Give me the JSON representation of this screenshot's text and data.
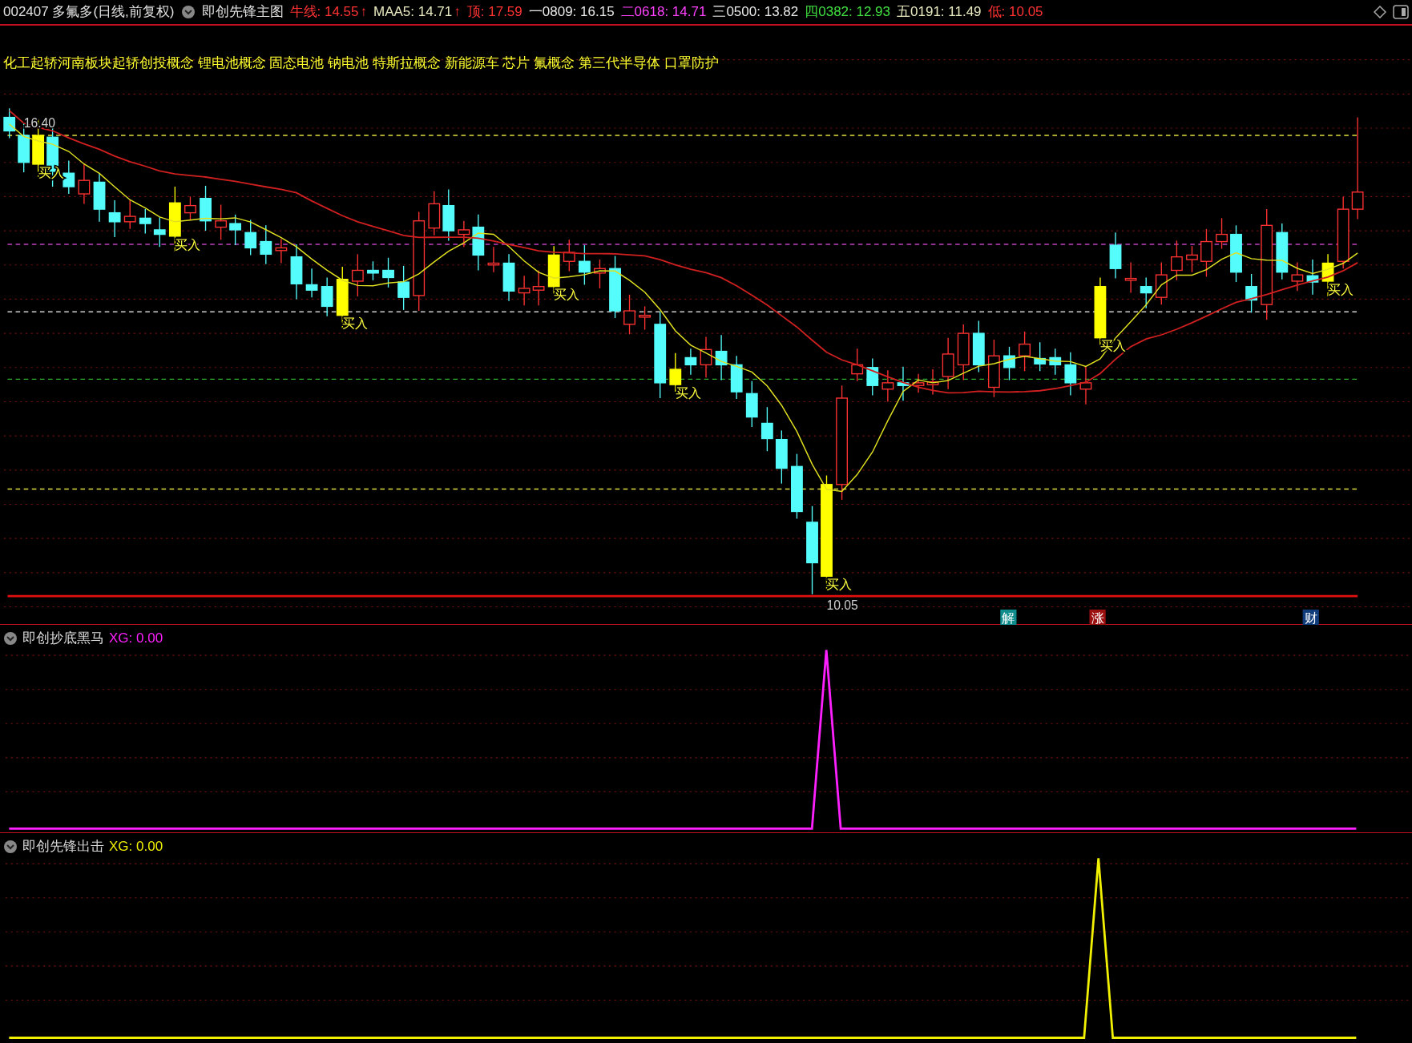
{
  "header": {
    "stock": "002407 多氟多(日线,前复权)",
    "indicator_name": "即创先锋主图",
    "values": [
      {
        "text": "牛线: 14.55",
        "arrow": "↑",
        "color": "#ff3232"
      },
      {
        "text": "MAA5: 14.71",
        "arrow": "↑",
        "color": "#e8e8c0"
      },
      {
        "text": "顶: 17.59",
        "color": "#ff3232"
      },
      {
        "text": "一0809: 16.15",
        "color": "#e8e8e8"
      },
      {
        "text": "二0618: 14.71",
        "color": "#ff40ff"
      },
      {
        "text": "三0500: 13.82",
        "color": "#e8e8e8"
      },
      {
        "text": "四0382: 12.93",
        "color": "#40e040"
      },
      {
        "text": "五0191: 11.49",
        "color": "#e8e8c0"
      },
      {
        "text": "低: 10.05",
        "color": "#ff3232"
      }
    ]
  },
  "concepts": "化工起轿河南板块起轿创投概念 锂电池概念 固态电池 钠电池 特斯拉概念 新能源车 芯片 氟概念 第三代半导体 口罩防护",
  "main_chart": {
    "high_label": "16.40",
    "low_label": "10.05",
    "signals": [
      "买入",
      "买入",
      "买入",
      "买入",
      "买入",
      "买入",
      "买入",
      "买入"
    ],
    "markers": [
      {
        "text": "解",
        "color": "#108c8c"
      },
      {
        "text": "涨",
        "color": "#9c1010"
      },
      {
        "text": "财",
        "color": "#103c7c"
      }
    ]
  },
  "panels": [
    {
      "title": "即创抄底黑马",
      "value": "XG: 0.00",
      "color": "#ff20ff"
    },
    {
      "title": "即创先锋出击",
      "value": "XG: 0.00",
      "color": "#f0f000"
    }
  ]
}
